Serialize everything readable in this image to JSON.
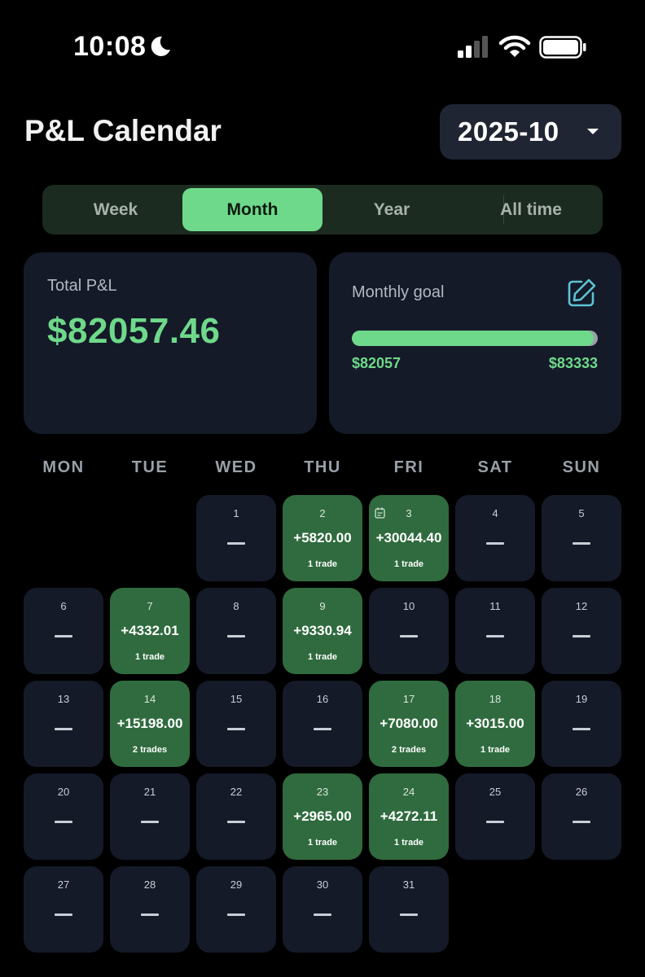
{
  "status_bar": {
    "time": "10:08"
  },
  "header": {
    "title": "P&L Calendar",
    "month": "2025-10"
  },
  "tabs": [
    {
      "label": "Week",
      "active": false
    },
    {
      "label": "Month",
      "active": true
    },
    {
      "label": "Year",
      "active": false
    },
    {
      "label": "All time",
      "active": false
    }
  ],
  "total": {
    "label": "Total P&L",
    "value": "$82057.46"
  },
  "goal": {
    "label": "Monthly goal",
    "current": "$82057",
    "target": "$83333",
    "progress": 0.985
  },
  "weekdays": [
    "MON",
    "TUE",
    "WED",
    "THU",
    "FRI",
    "SAT",
    "SUN"
  ],
  "calendar": {
    "first_weekday_index": 2,
    "days": [
      {
        "num": "1"
      },
      {
        "num": "2",
        "pnl": "+5820.00",
        "trades": "1 trade"
      },
      {
        "num": "3",
        "pnl": "+30044.40",
        "trades": "1 trade",
        "note": true
      },
      {
        "num": "4"
      },
      {
        "num": "5"
      },
      {
        "num": "6"
      },
      {
        "num": "7",
        "pnl": "+4332.01",
        "trades": "1 trade"
      },
      {
        "num": "8"
      },
      {
        "num": "9",
        "pnl": "+9330.94",
        "trades": "1 trade"
      },
      {
        "num": "10"
      },
      {
        "num": "11"
      },
      {
        "num": "12"
      },
      {
        "num": "13"
      },
      {
        "num": "14",
        "pnl": "+15198.00",
        "trades": "2 trades"
      },
      {
        "num": "15"
      },
      {
        "num": "16"
      },
      {
        "num": "17",
        "pnl": "+7080.00",
        "trades": "2 trades"
      },
      {
        "num": "18",
        "pnl": "+3015.00",
        "trades": "1 trade"
      },
      {
        "num": "19"
      },
      {
        "num": "20"
      },
      {
        "num": "21"
      },
      {
        "num": "22"
      },
      {
        "num": "23",
        "pnl": "+2965.00",
        "trades": "1 trade"
      },
      {
        "num": "24",
        "pnl": "+4272.11",
        "trades": "1 trade"
      },
      {
        "num": "25"
      },
      {
        "num": "26"
      },
      {
        "num": "27"
      },
      {
        "num": "28"
      },
      {
        "num": "29"
      },
      {
        "num": "30"
      },
      {
        "num": "31"
      }
    ]
  },
  "colors": {
    "accent": "#6ed98a",
    "card": "#141a28",
    "win_cell": "#2f6b3e"
  }
}
